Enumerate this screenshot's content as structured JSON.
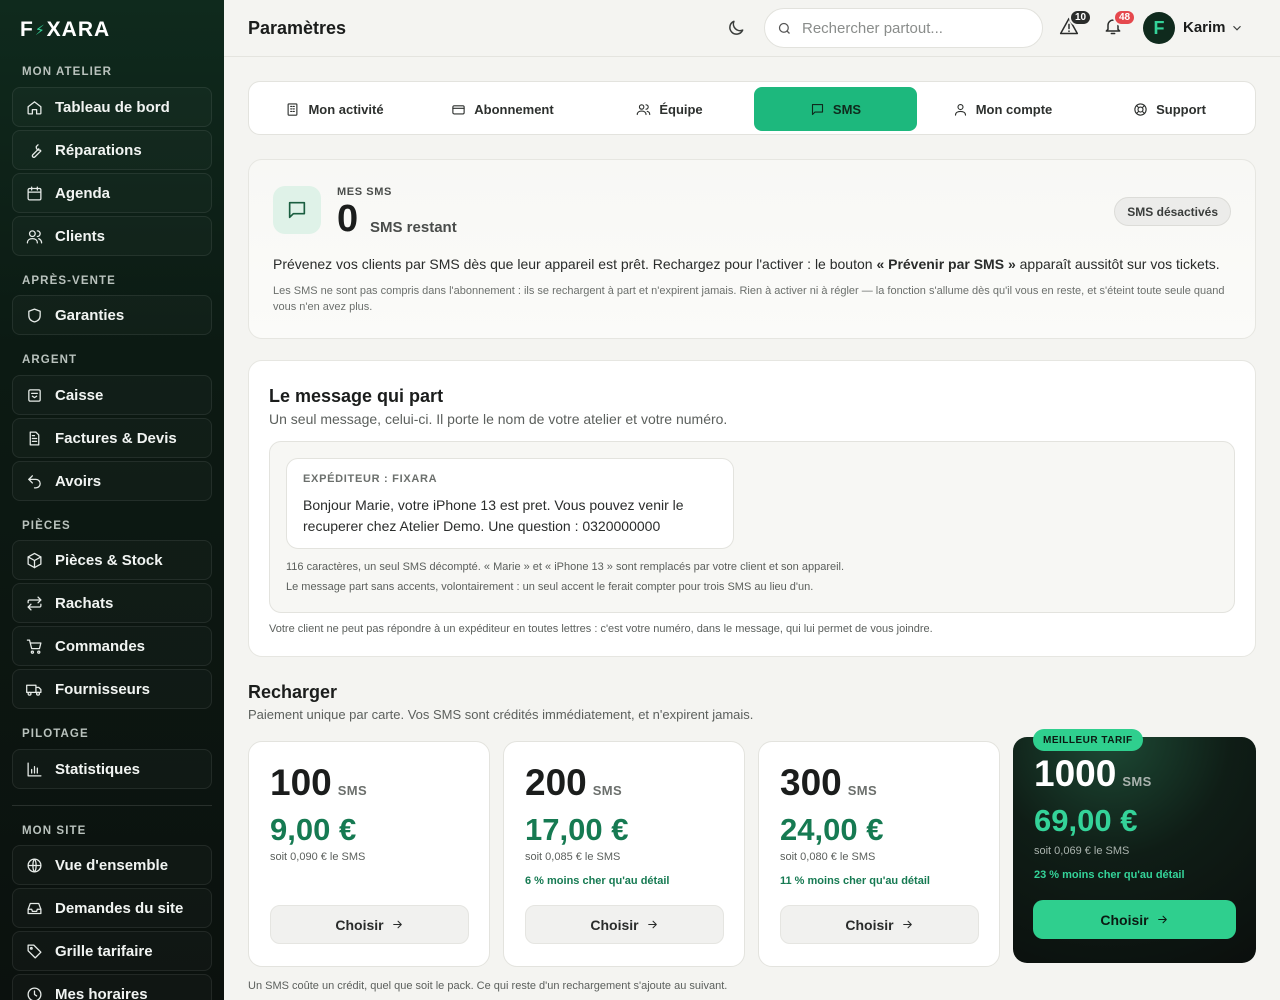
{
  "brand": {
    "logo_left": "F",
    "logo_right": "XARA"
  },
  "sidebar": {
    "sections": [
      {
        "label": "MON ATELIER"
      },
      {
        "label": "APRÈS-VENTE"
      },
      {
        "label": "ARGENT"
      },
      {
        "label": "PIÈCES"
      },
      {
        "label": "PILOTAGE"
      },
      {
        "label": "MON SITE"
      }
    ],
    "items": [
      {
        "label": "Tableau de bord",
        "icon": "home-icon"
      },
      {
        "label": "Réparations",
        "icon": "wrench-icon"
      },
      {
        "label": "Agenda",
        "icon": "calendar-icon"
      },
      {
        "label": "Clients",
        "icon": "users-icon"
      },
      {
        "label": "Garanties",
        "icon": "shield-icon"
      },
      {
        "label": "Caisse",
        "icon": "cash-register-icon"
      },
      {
        "label": "Factures & Devis",
        "icon": "document-icon"
      },
      {
        "label": "Avoirs",
        "icon": "undo-icon"
      },
      {
        "label": "Pièces & Stock",
        "icon": "box-icon"
      },
      {
        "label": "Rachats",
        "icon": "exchange-icon"
      },
      {
        "label": "Commandes",
        "icon": "cart-icon"
      },
      {
        "label": "Fournisseurs",
        "icon": "truck-icon"
      },
      {
        "label": "Statistiques",
        "icon": "bar-chart-icon"
      },
      {
        "label": "Vue d'ensemble",
        "icon": "globe-icon"
      },
      {
        "label": "Demandes du site",
        "icon": "inbox-icon"
      },
      {
        "label": "Grille tarifaire",
        "icon": "tag-icon"
      },
      {
        "label": "Mes horaires",
        "icon": "clock-icon"
      }
    ]
  },
  "header": {
    "title": "Paramètres",
    "search_placeholder": "Rechercher partout...",
    "alerts_count": "10",
    "notifications_count": "48",
    "user_initial": "F",
    "user_name": "Karim",
    "alerts_color": "#2a2c2b",
    "notifications_color": "#e5484d"
  },
  "tabs": [
    {
      "label": "Mon activité",
      "icon": "building-icon"
    },
    {
      "label": "Abonnement",
      "icon": "credit-card-icon"
    },
    {
      "label": "Équipe",
      "icon": "team-icon"
    },
    {
      "label": "SMS",
      "icon": "message-icon",
      "active": true
    },
    {
      "label": "Mon compte",
      "icon": "user-icon"
    },
    {
      "label": "Support",
      "icon": "lifebuoy-icon"
    }
  ],
  "sms": {
    "kicker": "MES SMS",
    "count": "0",
    "count_label": "SMS restant",
    "status": "SMS désactivés",
    "lead_before": "Prévenez vos clients par SMS dès que leur appareil est prêt. Rechargez pour l'activer : le bouton ",
    "lead_bold": "« Prévenir par SMS »",
    "lead_after": " apparaît aussitôt sur vos tickets.",
    "fine": "Les SMS ne sont pas compris dans l'abonnement : ils se rechargent à part et n'expirent jamais. Rien à activer ni à régler — la fonction s'allume dès qu'il vous en reste, et s'éteint toute seule quand vous n'en avez plus."
  },
  "message": {
    "title": "Le message qui part",
    "subtitle": "Un seul message, celui-ci. Il porte le nom de votre atelier et votre numéro.",
    "sender": "EXPÉDITEUR : FIXARA",
    "text": "Bonjour Marie, votre iPhone 13 est pret. Vous pouvez venir le recuperer chez Atelier Demo. Une question : 0320000000",
    "note1": "116 caractères, un seul SMS décompté. « Marie » et « iPhone 13 » sont remplacés par votre client et son appareil.",
    "note2": "Le message part sans accents, volontairement : un seul accent le ferait compter pour trois SMS au lieu d'un.",
    "footer": "Votre client ne peut pas répondre à un expéditeur en toutes lettres : c'est votre numéro, dans le message, qui lui permet de vous joindre."
  },
  "recharge": {
    "title": "Recharger",
    "subtitle": "Paiement unique par carte. Vos SMS sont crédités immédiatement, et n'expirent jamais.",
    "unit": "SMS",
    "choose_label": "Choisir",
    "best_tag": "MEILLEUR TARIF",
    "plans": [
      {
        "qty": "100",
        "price": "9,00 €",
        "per": "soit 0,090 € le SMS",
        "saving": ""
      },
      {
        "qty": "200",
        "price": "17,00 €",
        "per": "soit 0,085 € le SMS",
        "saving": "6 % moins cher qu'au détail"
      },
      {
        "qty": "300",
        "price": "24,00 €",
        "per": "soit 0,080 € le SMS",
        "saving": "11 % moins cher qu'au détail"
      },
      {
        "qty": "1000",
        "price": "69,00 €",
        "per": "soit 0,069 € le SMS",
        "saving": "23 % moins cher qu'au détail"
      }
    ],
    "note": "Un SMS coûte un crédit, quel que soit le pack. Ce qui reste d'un rechargement s'ajoute au suivant."
  },
  "colors": {
    "accent": "#1db87d",
    "price_green": "#167a52",
    "sidebar_bg": "#0c1a13"
  }
}
